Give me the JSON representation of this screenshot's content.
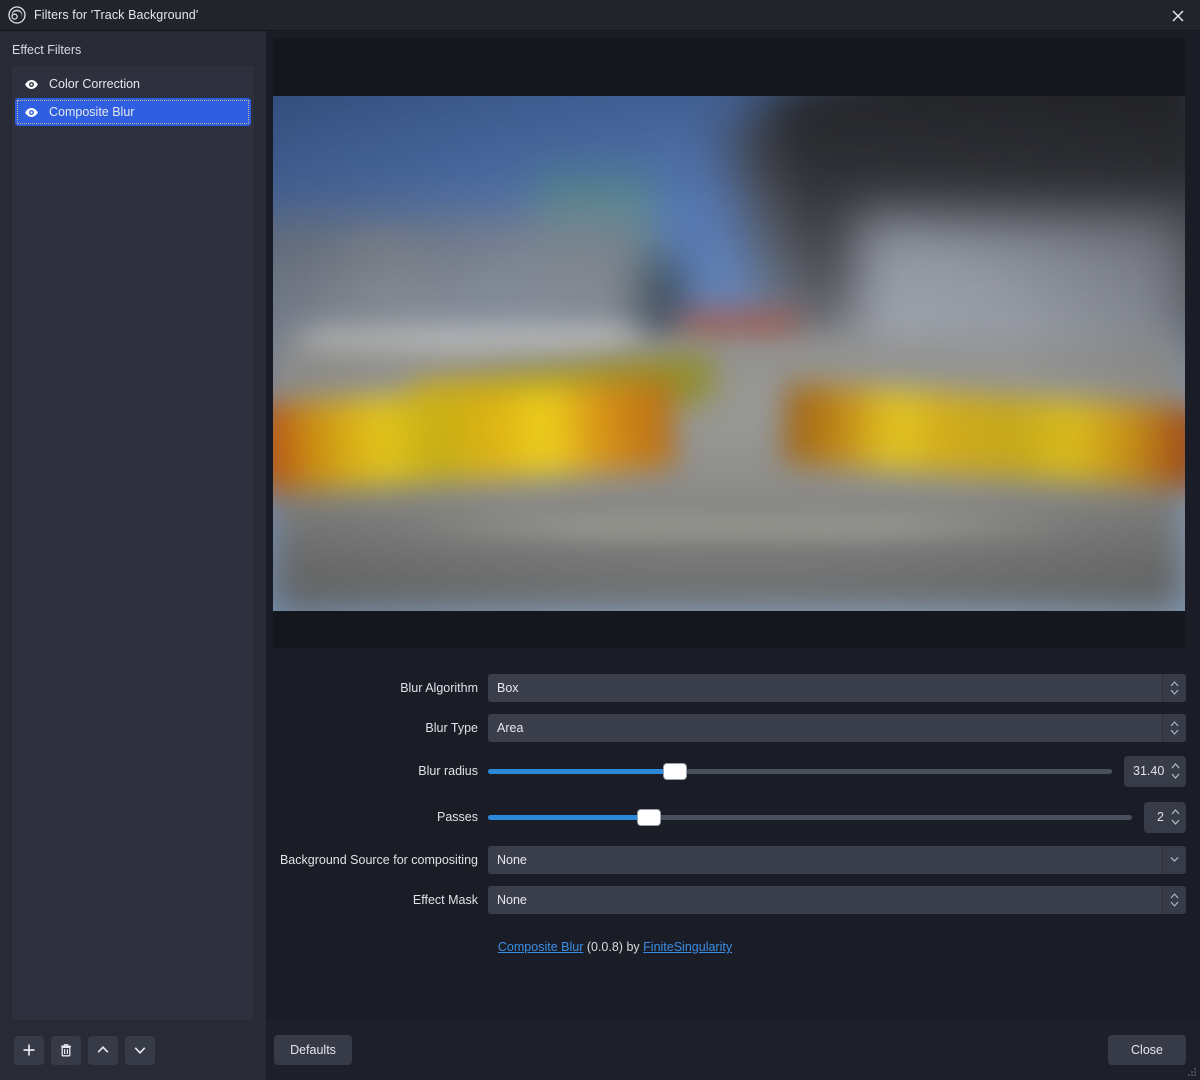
{
  "window": {
    "title": "Filters for 'Track Background'",
    "logo_icon": "obs-logo-icon",
    "close_icon": "close-icon"
  },
  "sidebar": {
    "header": "Effect Filters",
    "items": [
      {
        "label": "Color Correction",
        "visible_icon": "eye-icon",
        "selected": false
      },
      {
        "label": "Composite Blur",
        "visible_icon": "eye-icon",
        "selected": true
      }
    ],
    "toolbar": [
      {
        "name": "add-filter-button",
        "icon": "plus-icon"
      },
      {
        "name": "remove-filter-button",
        "icon": "trash-icon"
      },
      {
        "name": "move-filter-up-button",
        "icon": "chevron-up-icon"
      },
      {
        "name": "move-filter-down-button",
        "icon": "chevron-down-icon"
      }
    ]
  },
  "preview": {
    "alt": "Blurred racetrack straight with grandstands and yellow-red kerb barriers"
  },
  "form": {
    "blur_algorithm": {
      "label": "Blur Algorithm",
      "value": "Box"
    },
    "blur_type": {
      "label": "Blur Type",
      "value": "Area"
    },
    "blur_radius": {
      "label": "Blur radius",
      "value": "31.40",
      "percent": 30
    },
    "passes": {
      "label": "Passes",
      "value": "2",
      "percent": 25
    },
    "background_source": {
      "label": "Background Source for compositing",
      "value": "None"
    },
    "effect_mask": {
      "label": "Effect Mask",
      "value": "None"
    }
  },
  "credits": {
    "plugin_name": "Composite Blur",
    "version": "(0.0.8)",
    "by": "by",
    "author": "FiniteSingularity"
  },
  "footer": {
    "defaults_label": "Defaults",
    "close_label": "Close"
  },
  "colors": {
    "accent_blue": "#2f5fe0",
    "slider_blue": "#2b87d8",
    "link_blue": "#3b8ee8",
    "panel_bg": "#282b36",
    "form_bg": "#1b1d26",
    "control_bg": "#3b3f4c"
  }
}
